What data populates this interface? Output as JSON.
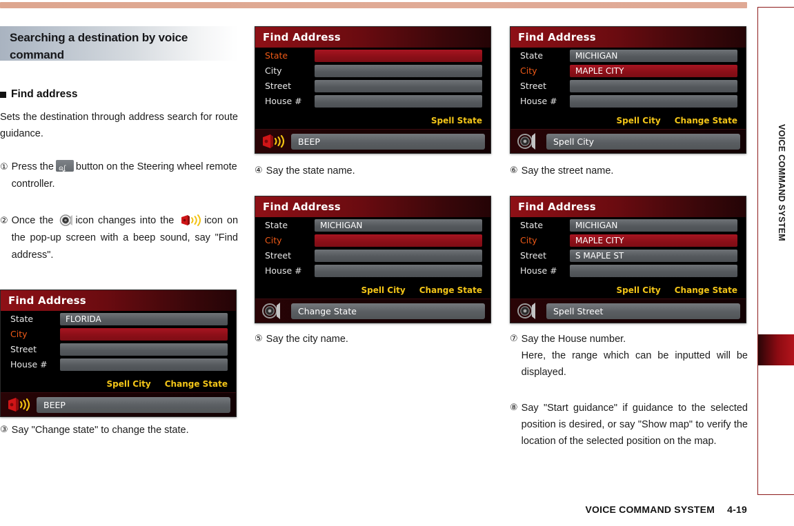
{
  "top_rule_color": "#dda68f",
  "accent_red": "#8e1016",
  "highlight_red": "#a81522",
  "command_yellow": "#f3c518",
  "active_label_orange": "#ef5a17",
  "section": {
    "header": "Searching a destination by voice command",
    "bullet_title": "Find address",
    "intro": "Sets the destination through address search for route guidance."
  },
  "steps": {
    "s1": {
      "num": "①",
      "pre": "Press the",
      "post": "button on the Steering wheel remote controller."
    },
    "s2": {
      "num": "②",
      "a": "Once the",
      "b": "icon changes into the",
      "c": "icon on the pop-up screen with a beep sound, say \"Find address\"."
    },
    "s3": {
      "num": "③",
      "text": "Say \"Change state\" to change the state."
    },
    "s4": {
      "num": "④",
      "text": "Say the state name."
    },
    "s5": {
      "num": "⑤",
      "text": "Say the city name."
    },
    "s6": {
      "num": "⑥",
      "text": "Say the street name."
    },
    "s7": {
      "num": "⑦",
      "text": "Say the House number.",
      "text2": "Here, the range which can be inputted will be displayed."
    },
    "s8": {
      "num": "⑧",
      "text": "Say \"Start guidance\" if guidance to the selected position is desired, or say \"Show map\" to verify the location of the selected position on the map."
    }
  },
  "nav_screens": [
    {
      "id": "nav-florida",
      "title": "Find Address",
      "rows": [
        {
          "label": "State",
          "value": "FLORIDA",
          "active": false,
          "highlight": false
        },
        {
          "label": "City",
          "value": "",
          "active": true,
          "highlight": true
        },
        {
          "label": "Street",
          "value": "",
          "active": false,
          "highlight": false
        },
        {
          "label": "House #",
          "value": "",
          "active": false,
          "highlight": false
        }
      ],
      "commands": [
        "Spell City",
        "Change State"
      ],
      "prompt": "BEEP",
      "icon": "mic-icon"
    },
    {
      "id": "nav-state-empty",
      "title": "Find Address",
      "rows": [
        {
          "label": "State",
          "value": "",
          "active": true,
          "highlight": true
        },
        {
          "label": "City",
          "value": "",
          "active": false,
          "highlight": false
        },
        {
          "label": "Street",
          "value": "",
          "active": false,
          "highlight": false
        },
        {
          "label": "House #",
          "value": "",
          "active": false,
          "highlight": false
        }
      ],
      "commands": [
        "Spell State"
      ],
      "prompt": "BEEP",
      "icon": "mic-icon"
    },
    {
      "id": "nav-michigan-city",
      "title": "Find Address",
      "rows": [
        {
          "label": "State",
          "value": "MICHIGAN",
          "active": false,
          "highlight": false
        },
        {
          "label": "City",
          "value": "",
          "active": true,
          "highlight": true
        },
        {
          "label": "Street",
          "value": "",
          "active": false,
          "highlight": false
        },
        {
          "label": "House #",
          "value": "",
          "active": false,
          "highlight": false
        }
      ],
      "commands": [
        "Spell City",
        "Change State"
      ],
      "prompt": "Change State",
      "icon": "speaker-icon"
    },
    {
      "id": "nav-maple-city",
      "title": "Find Address",
      "rows": [
        {
          "label": "State",
          "value": "MICHIGAN",
          "active": false,
          "highlight": false
        },
        {
          "label": "City",
          "value": "MAPLE CITY",
          "active": true,
          "highlight": true
        },
        {
          "label": "Street",
          "value": "",
          "active": false,
          "highlight": false
        },
        {
          "label": "House #",
          "value": "",
          "active": false,
          "highlight": false
        }
      ],
      "commands": [
        "Spell City",
        "Change State"
      ],
      "prompt": "Spell City",
      "icon": "speaker-icon"
    },
    {
      "id": "nav-maple-street",
      "title": "Find Address",
      "rows": [
        {
          "label": "State",
          "value": "MICHIGAN",
          "active": false,
          "highlight": false
        },
        {
          "label": "City",
          "value": "MAPLE CITY",
          "active": true,
          "highlight": true
        },
        {
          "label": "Street",
          "value": "S MAPLE ST",
          "active": false,
          "highlight": false
        },
        {
          "label": "House #",
          "value": "",
          "active": false,
          "highlight": false
        }
      ],
      "commands": [
        "Spell City",
        "Change State"
      ],
      "prompt": "Spell Street",
      "icon": "speaker-icon"
    }
  ],
  "sidebar": {
    "label": "VOICE COMMAND SYSTEM"
  },
  "footer": {
    "chapter": "VOICE COMMAND SYSTEM",
    "page": "4-19"
  }
}
